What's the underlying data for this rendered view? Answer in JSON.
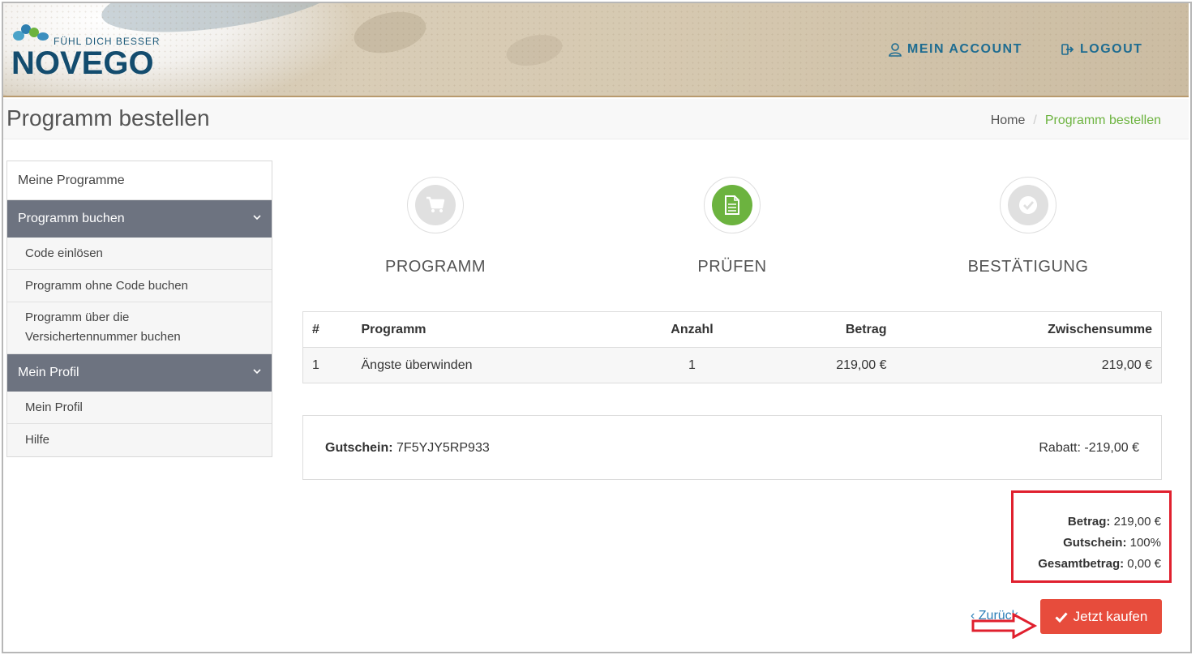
{
  "header": {
    "logo_tagline": "FÜHL DICH BESSER",
    "logo_name": "NOVEGO",
    "nav": [
      {
        "label": "MEIN ACCOUNT",
        "icon": "user-icon"
      },
      {
        "label": "LOGOUT",
        "icon": "sign-out-icon"
      }
    ]
  },
  "title_bar": {
    "title": "Programm bestellen",
    "breadcrumb": [
      {
        "label": "Home"
      },
      {
        "label": "Programm bestellen"
      }
    ]
  },
  "sidebar": {
    "top_item": "Meine Programme",
    "sections": [
      {
        "title": "Programm buchen",
        "items": [
          {
            "label": "Code einlösen"
          },
          {
            "label": "Programm ohne Code buchen"
          },
          {
            "label": "Programm über die Versichertennummer buchen"
          }
        ]
      },
      {
        "title": "Mein Profil",
        "items": [
          {
            "label": "Mein Profil"
          },
          {
            "label": "Hilfe"
          }
        ]
      }
    ]
  },
  "steps": [
    {
      "label": "PROGRAMM",
      "icon": "shopping-cart-icon",
      "active": false
    },
    {
      "label": "PRÜFEN",
      "icon": "document-icon",
      "active": true
    },
    {
      "label": "BESTÄTIGUNG",
      "icon": "check-icon",
      "active": false
    }
  ],
  "order_table": {
    "headers": [
      "#",
      "Programm",
      "Anzahl",
      "Betrag",
      "Zwischensumme"
    ],
    "rows": [
      [
        "1",
        "Ängste überwinden",
        "1",
        "219,00 €",
        "219,00 €"
      ]
    ]
  },
  "coupon": {
    "label": "Gutschein:",
    "code": "7F5YJY5RP933",
    "discount": "Rabatt: -219,00 €"
  },
  "summary": {
    "betrag_label": "Betrag:",
    "betrag_value": "219,00 €",
    "gutschein_label": "Gutschein:",
    "gutschein_value": "100%",
    "gesamt_label": "Gesamtbetrag:",
    "gesamt_value": "0,00 €"
  },
  "actions": {
    "back_label": "‹ Zurück",
    "buy_label": "Jetzt kaufen"
  },
  "colors": {
    "accent_green": "#6cb33f",
    "nav_blue": "#1e6c91",
    "sidebar_header": "#6d7380",
    "buy_button": "#e74c3c",
    "highlight_red": "#e0202e"
  }
}
